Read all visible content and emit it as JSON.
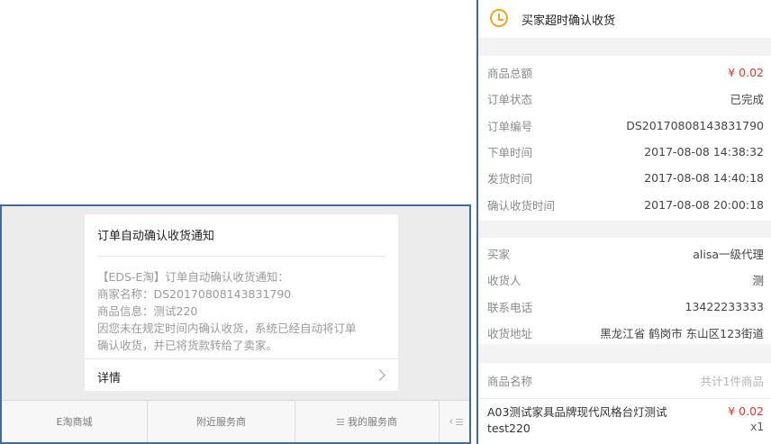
{
  "notification": {
    "title": "订单自动确认收货通知",
    "body_lines": [
      "【EDS-E淘】订单自动确认收货通知：",
      "商家名称：DS20170808143831790",
      "商品信息：测试220",
      "因您未在规定时间内确认收货，系统已经自动将订单",
      "确认收货，并已将货款转给了卖家。"
    ],
    "detail_label": "详情"
  },
  "menu": {
    "items": [
      "E淘商城",
      "附近服务商",
      "我的服务商"
    ]
  },
  "order": {
    "header_title": "买家超时确认收货",
    "info_rows": [
      {
        "label": "商品总额",
        "value": "¥ 0.02"
      },
      {
        "label": "订单状态",
        "value": "已完成"
      },
      {
        "label": "订单编号",
        "value": "DS20170808143831790"
      },
      {
        "label": "下单时间",
        "value": "2017-08-08 14:38:32"
      },
      {
        "label": "发货时间",
        "value": "2017-08-08 14:40:18"
      },
      {
        "label": "确认收货时间",
        "value": "2017-08-08 20:00:18"
      }
    ],
    "buyer_rows": [
      {
        "label": "买家",
        "value": "alisa一级代理"
      },
      {
        "label": "收货人",
        "value": "测"
      },
      {
        "label": "联系电话",
        "value": "13422233333"
      },
      {
        "label": "收货地址",
        "value": "黑龙江省 鹤岗市 东山区123街道"
      }
    ],
    "product_header": {
      "label": "商品名称",
      "count": "共计1件商品"
    },
    "product": {
      "name": "A03测试家具品牌现代风格台灯测试test220",
      "price": "¥ 0.02",
      "qty": "x1"
    }
  },
  "colors": {
    "frame_border": "#3e6aa8",
    "price_red": "#e8332a",
    "clock_orange": "#f2a71e"
  }
}
